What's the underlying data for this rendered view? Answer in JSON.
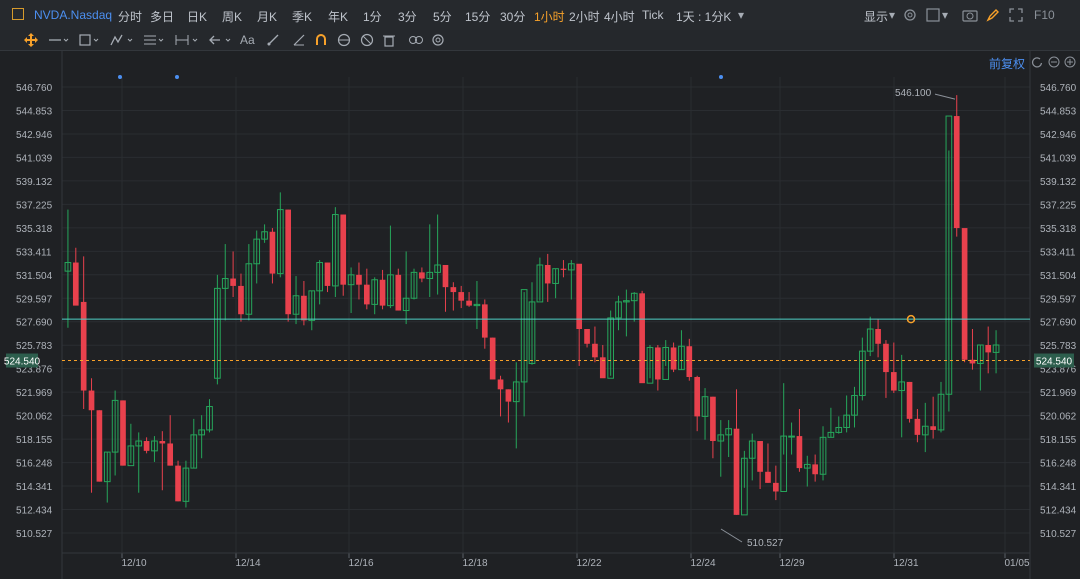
{
  "topbar": {
    "symbol": "NVDA.Nasdaq",
    "timeframes": [
      "分时",
      "多日",
      "日K",
      "周K",
      "月K",
      "季K",
      "年K",
      "1分",
      "3分",
      "5分",
      "15分",
      "30分",
      "1小时",
      "2小时",
      "4小时",
      "Tick"
    ],
    "active_timeframe": "1小时",
    "range_label": "1天 : 1分K",
    "display_label": "显示",
    "fq_label": "前复权",
    "colors": {
      "accent": "#f7a12a",
      "symbol": "#4c8ff0",
      "up": "#26a65b",
      "down": "#e8414d"
    }
  },
  "icons": {
    "toolbar": [
      "move-icon",
      "line-icon",
      "rect-icon",
      "pattern-icon",
      "fib-icon",
      "measure-icon",
      "arrow-icon",
      "text-icon",
      "pencil-icon",
      "magnet-icon",
      "lock-icon",
      "hide-icon",
      "delete-icon",
      "link-icon",
      "settings-icon"
    ],
    "topbar_right": [
      "settings-icon",
      "square-icon",
      "camera-icon",
      "pencil-icon",
      "expand-icon",
      "f10-icon"
    ]
  },
  "chart_data": {
    "type": "candlestick",
    "title": "",
    "y_ticks": [
      "546.760",
      "544.853",
      "542.946",
      "541.039",
      "539.132",
      "537.225",
      "535.318",
      "533.411",
      "531.504",
      "529.597",
      "527.690",
      "525.783",
      "523.876",
      "521.969",
      "520.062",
      "518.155",
      "516.248",
      "514.341",
      "512.434",
      "510.527"
    ],
    "ylim": [
      510.527,
      546.76
    ],
    "x_ticks": [
      "12/10",
      "12/14",
      "12/16",
      "12/18",
      "12/22",
      "12/24",
      "12/29",
      "12/31",
      "01/05"
    ],
    "current_price": "524.540",
    "high_label": "546.100",
    "low_label": "510.527",
    "horizontal_line": 527.9,
    "candles": [
      [
        531.8,
        536.8,
        527.2,
        532.5
      ],
      [
        532.5,
        533.7,
        529.6,
        529.0
      ],
      [
        529.3,
        533.0,
        520.6,
        522.1
      ],
      [
        522.1,
        523.1,
        513.8,
        520.5
      ],
      [
        520.5,
        520.5,
        514.7,
        514.7
      ],
      [
        514.7,
        517.1,
        513.0,
        517.1
      ],
      [
        517.1,
        522.1,
        515.2,
        521.3
      ],
      [
        521.3,
        521.3,
        516.0,
        516.0
      ],
      [
        516.0,
        519.4,
        516.2,
        517.6
      ],
      [
        517.6,
        518.7,
        513.8,
        518.0
      ],
      [
        518.0,
        518.3,
        517.0,
        517.2
      ],
      [
        517.2,
        518.4,
        516.3,
        518.0
      ],
      [
        518.0,
        518.8,
        514.0,
        517.8
      ],
      [
        517.8,
        520.1,
        516.0,
        516.0
      ],
      [
        516.0,
        516.4,
        513.1,
        513.1
      ],
      [
        513.1,
        516.4,
        512.6,
        515.8
      ],
      [
        515.8,
        519.8,
        515.8,
        518.5
      ],
      [
        518.5,
        520.1,
        516.6,
        518.9
      ],
      [
        518.9,
        521.4,
        518.7,
        520.8
      ],
      [
        523.1,
        531.5,
        522.6,
        530.4
      ],
      [
        530.4,
        534.0,
        527.8,
        531.2
      ],
      [
        531.2,
        533.4,
        529.7,
        530.6
      ],
      [
        530.6,
        531.6,
        527.7,
        528.3
      ],
      [
        528.3,
        534.0,
        527.8,
        532.4
      ],
      [
        532.4,
        535.1,
        530.8,
        534.4
      ],
      [
        534.4,
        535.6,
        534.1,
        535.0
      ],
      [
        535.0,
        535.3,
        530.8,
        531.6
      ],
      [
        531.6,
        538.2,
        531.3,
        536.8
      ],
      [
        536.8,
        536.8,
        527.7,
        528.3
      ],
      [
        528.3,
        531.4,
        527.5,
        529.8
      ],
      [
        529.8,
        531.0,
        527.4,
        527.8
      ],
      [
        527.8,
        530.2,
        527.0,
        530.2
      ],
      [
        530.2,
        532.7,
        529.1,
        532.5
      ],
      [
        532.5,
        532.5,
        530.1,
        530.6
      ],
      [
        530.6,
        537.0,
        529.7,
        536.4
      ],
      [
        536.4,
        536.4,
        529.8,
        530.7
      ],
      [
        530.7,
        532.1,
        528.4,
        531.5
      ],
      [
        531.5,
        532.5,
        529.5,
        530.7
      ],
      [
        530.7,
        532.0,
        528.7,
        529.1
      ],
      [
        529.1,
        531.3,
        528.3,
        531.1
      ],
      [
        531.1,
        531.9,
        528.7,
        529.0
      ],
      [
        529.0,
        535.5,
        528.8,
        531.5
      ],
      [
        531.5,
        532.0,
        528.6,
        528.6
      ],
      [
        528.6,
        533.4,
        527.5,
        529.6
      ],
      [
        529.6,
        532.0,
        529.5,
        531.7
      ],
      [
        531.7,
        532.1,
        530.9,
        531.2
      ],
      [
        531.2,
        535.6,
        529.7,
        531.7
      ],
      [
        531.7,
        536.4,
        529.9,
        532.3
      ],
      [
        532.3,
        532.3,
        528.5,
        530.5
      ],
      [
        530.5,
        530.9,
        528.6,
        530.1
      ],
      [
        530.1,
        530.6,
        528.8,
        529.4
      ],
      [
        529.4,
        530.1,
        528.9,
        529.0
      ],
      [
        529.0,
        531.0,
        527.1,
        529.1
      ],
      [
        529.1,
        529.5,
        525.5,
        526.4
      ],
      [
        526.4,
        526.4,
        523.3,
        523.0
      ],
      [
        523.0,
        523.3,
        520.0,
        522.2
      ],
      [
        522.2,
        522.2,
        519.5,
        521.2
      ],
      [
        521.2,
        524.4,
        517.4,
        522.8
      ],
      [
        522.8,
        530.1,
        520.0,
        530.3
      ],
      [
        524.3,
        530.9,
        524.2,
        529.3
      ],
      [
        529.3,
        532.9,
        529.4,
        532.3
      ],
      [
        532.3,
        533.2,
        529.3,
        530.8
      ],
      [
        530.8,
        532.0,
        529.6,
        532.0
      ],
      [
        532.0,
        532.7,
        531.3,
        531.9
      ],
      [
        531.9,
        532.7,
        529.5,
        532.4
      ],
      [
        532.4,
        531.8,
        524.1,
        527.1
      ],
      [
        527.1,
        527.1,
        525.6,
        525.9
      ],
      [
        525.9,
        527.3,
        524.4,
        524.8
      ],
      [
        524.8,
        525.8,
        524.2,
        523.1
      ],
      [
        523.1,
        528.6,
        523.3,
        528.0
      ],
      [
        528.0,
        529.8,
        527.0,
        529.3
      ],
      [
        529.3,
        530.3,
        526.5,
        529.4
      ],
      [
        529.4,
        530.1,
        527.7,
        530.0
      ],
      [
        530.0,
        530.2,
        523.8,
        522.7
      ],
      [
        522.7,
        525.8,
        523.1,
        525.6
      ],
      [
        525.6,
        525.8,
        522.1,
        523.0
      ],
      [
        523.0,
        526.2,
        524.1,
        525.6
      ],
      [
        525.6,
        526.0,
        523.6,
        523.8
      ],
      [
        523.8,
        527.0,
        523.8,
        525.7
      ],
      [
        525.7,
        526.3,
        522.9,
        523.2
      ],
      [
        523.2,
        523.3,
        518.8,
        520.0
      ],
      [
        520.0,
        522.3,
        518.1,
        521.6
      ],
      [
        521.6,
        521.6,
        516.6,
        518.0
      ],
      [
        518.0,
        519.7,
        515.1,
        518.5
      ],
      [
        518.5,
        519.7,
        516.7,
        519.0
      ],
      [
        519.0,
        522.2,
        512.0,
        512.0
      ],
      [
        512.0,
        517.2,
        514.2,
        516.6
      ],
      [
        516.6,
        518.6,
        514.8,
        518.0
      ],
      [
        518.0,
        518.0,
        514.1,
        515.5
      ],
      [
        515.5,
        517.8,
        514.6,
        514.6
      ],
      [
        514.6,
        516.0,
        513.2,
        513.9
      ],
      [
        513.9,
        522.7,
        516.9,
        518.4
      ],
      [
        518.4,
        519.5,
        516.9,
        518.4
      ],
      [
        518.4,
        520.6,
        515.5,
        515.8
      ],
      [
        515.8,
        516.8,
        514.3,
        516.1
      ],
      [
        516.1,
        516.9,
        514.7,
        515.3
      ],
      [
        515.3,
        519.2,
        514.8,
        518.3
      ],
      [
        518.3,
        520.7,
        518.3,
        518.7
      ],
      [
        518.7,
        520.0,
        518.6,
        519.1
      ],
      [
        519.1,
        521.7,
        518.7,
        520.1
      ],
      [
        520.1,
        522.4,
        519.1,
        521.7
      ],
      [
        521.7,
        526.4,
        521.3,
        525.3
      ],
      [
        525.3,
        528.1,
        524.9,
        527.1
      ],
      [
        527.1,
        527.9,
        524.8,
        525.9
      ],
      [
        525.9,
        526.2,
        521.5,
        523.6
      ],
      [
        523.6,
        526.0,
        521.9,
        522.1
      ],
      [
        522.1,
        525.0,
        518.3,
        522.8
      ],
      [
        522.8,
        522.8,
        519.5,
        519.8
      ],
      [
        519.8,
        520.6,
        517.9,
        518.5
      ],
      [
        518.5,
        521.1,
        517.1,
        519.2
      ],
      [
        519.2,
        521.6,
        518.2,
        518.9
      ],
      [
        518.9,
        522.8,
        518.7,
        521.8
      ],
      [
        521.8,
        541.6,
        520.4,
        544.4
      ],
      [
        544.4,
        546.1,
        534.6,
        535.3
      ],
      [
        535.3,
        532.3,
        524.4,
        524.6
      ],
      [
        524.6,
        527.1,
        523.8,
        524.3
      ],
      [
        524.3,
        525.8,
        522.1,
        525.8
      ],
      [
        525.8,
        527.3,
        523.5,
        525.2
      ],
      [
        525.2,
        527.0,
        523.5,
        525.8
      ]
    ]
  }
}
